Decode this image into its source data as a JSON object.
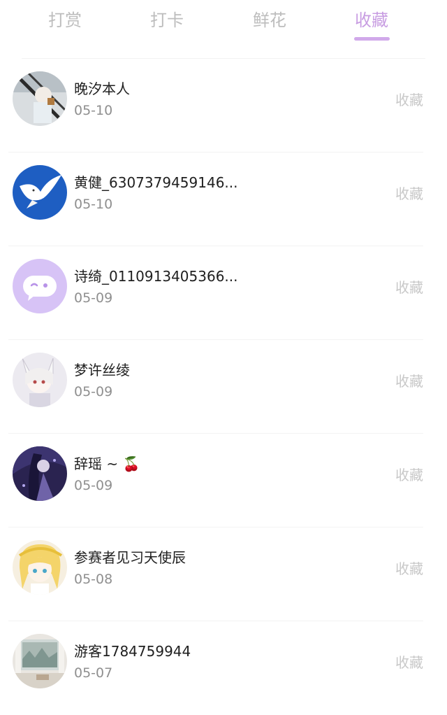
{
  "tabs": [
    {
      "label": "打赏"
    },
    {
      "label": "打卡"
    },
    {
      "label": "鲜花"
    },
    {
      "label": "收藏"
    }
  ],
  "active_tab": 3,
  "colors": {
    "accent": "#c89de2",
    "inactive_tab": "#bdbdbd",
    "action": "#c8c8c8"
  },
  "items": [
    {
      "name": "晚汐本人",
      "date": "05-10",
      "action": "收藏",
      "avatar": "photo-avatar"
    },
    {
      "name": "黄健_6307379459146...",
      "date": "05-10",
      "action": "收藏",
      "avatar": "dove-avatar"
    },
    {
      "name": "诗绮_0110913405366...",
      "date": "05-09",
      "action": "收藏",
      "avatar": "default-chat-avatar"
    },
    {
      "name": "梦许丝绫",
      "date": "05-09",
      "action": "收藏",
      "avatar": "anime-avatar"
    },
    {
      "name": "辞瑶 ~ 🍒",
      "date": "05-09",
      "action": "收藏",
      "avatar": "dark-anime-avatar"
    },
    {
      "name": "参赛者见习天使辰",
      "date": "05-08",
      "action": "收藏",
      "avatar": "blonde-anime-avatar"
    },
    {
      "name": "游客1784759944",
      "date": "05-07",
      "action": "收藏",
      "avatar": "room-photo-avatar"
    }
  ]
}
